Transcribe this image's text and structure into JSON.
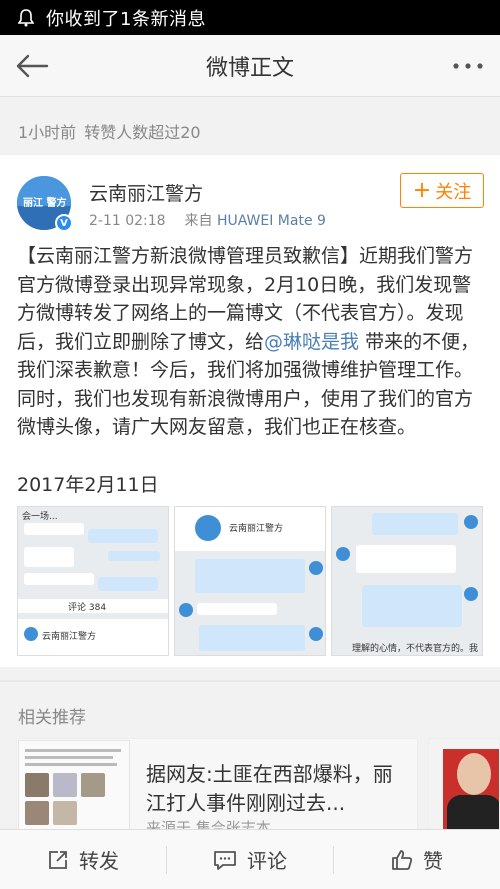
{
  "status_bar": {
    "notification_text": "你收到了1条新消息"
  },
  "header": {
    "title": "微博正文"
  },
  "meta": {
    "time_ago": "1小时前",
    "repost_note": "转赞人数超过20"
  },
  "post": {
    "author": "云南丽江警方",
    "avatar_text": "丽江 警方",
    "timestamp": "2-11 02:18",
    "source_prefix": "来自",
    "device": "HUAWEI Mate 9",
    "follow_label": "关注",
    "text_before_mention": "【云南丽江警方新浪微博管理员致歉信】近期我们警方官方微博登录出现异常现象，2月10日晚，我们发现警方微博转发了网络上的一篇博文（不代表官方）。发现后，我们立即删除了博文，给",
    "mention": "@琳哒是我",
    "text_after_mention": " 带来的不便，我们深表歉意！今后，我们将加强微博维护管理工作。同时，我们也发现有新浪微博用户，使用了我们的官方微博头像，请广大网友留意，我们也正在核查。",
    "date_line": "2017年2月11日",
    "images": [
      {
        "label_1": "会一场...",
        "label_2": "评论 384",
        "label_3": "云南丽江警方"
      },
      {
        "label_1": "云南丽江警方"
      },
      {
        "label_1": "理解的心情，不代表官方的。我"
      }
    ]
  },
  "related": {
    "section_title": "相关推荐",
    "headline": "据网友:土匪在西部爆料，丽江打人事件刚刚过去...",
    "source": "来源于 集合张志本"
  },
  "bottom_bar": {
    "repost_label": "转发",
    "comment_label": "评论",
    "like_label": "赞"
  }
}
